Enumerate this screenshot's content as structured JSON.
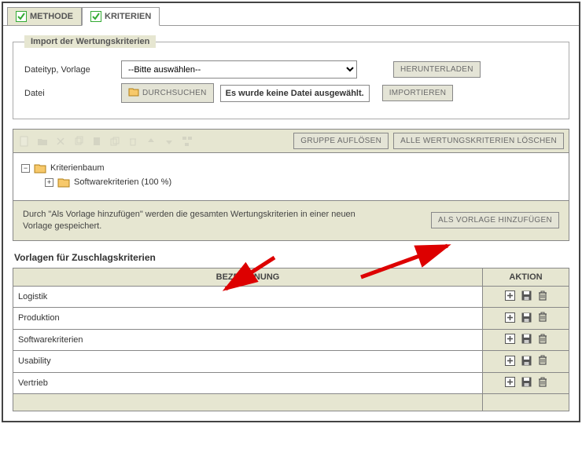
{
  "tabs": {
    "methode": "METHODE",
    "kriterien": "KRITERIEN"
  },
  "import": {
    "legend": "Import der Wertungskriterien",
    "filetype_label": "Dateityp, Vorlage",
    "filetype_placeholder": "--Bitte auswählen--",
    "file_label": "Datei",
    "browse_btn": "DURCHSUCHEN",
    "file_status": "Es wurde keine Datei ausgewählt.",
    "download_btn": "HERUNTERLADEN",
    "import_btn": "IMPORTIEREN"
  },
  "toolbar": {
    "dissolve_group_btn": "GRUPPE AUFLÖSEN",
    "delete_all_btn": "ALLE WERTUNGSKRITERIEN LÖSCHEN"
  },
  "tree": {
    "root": "Kriterienbaum",
    "child": "Softwarekriterien (100 %)"
  },
  "hint": {
    "text": "Durch \"Als Vorlage hinzufügen\" werden die gesamten Wertungskriterien in einer neuen Vorlage gespeichert.",
    "add_template_btn": "ALS VORLAGE HINZUFÜGEN"
  },
  "templates": {
    "title": "Vorlagen für Zuschlagskriterien",
    "col_name": "BEZEICHNUNG",
    "col_action": "AKTION",
    "rows": [
      "Logistik",
      "Produktion",
      "Softwarekriterien",
      "Usability",
      "Vertrieb"
    ]
  }
}
